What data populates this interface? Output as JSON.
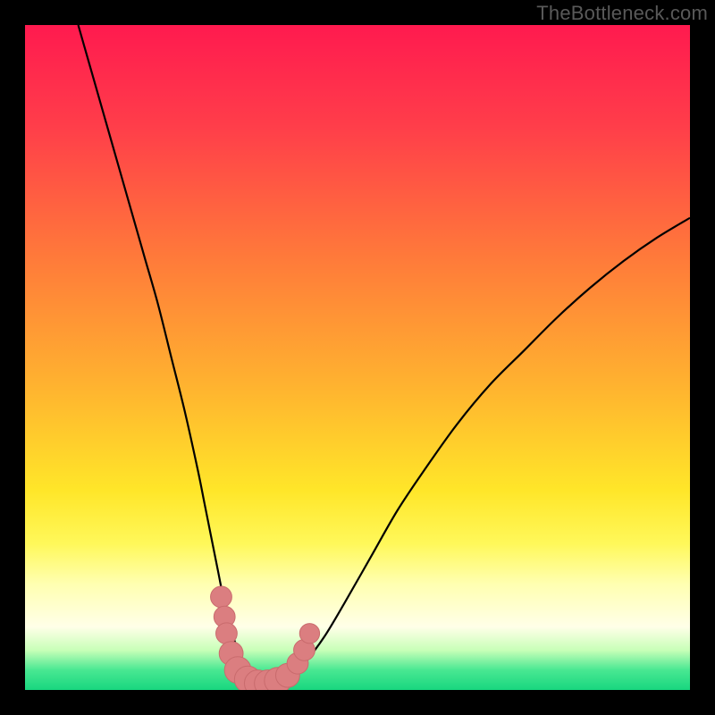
{
  "watermark": "TheBottleneck.com",
  "colors": {
    "frame": "#000000",
    "curve": "#000000",
    "marker_fill": "#db7e80",
    "marker_stroke": "#c96b6d",
    "gradient_stops": [
      {
        "offset": 0.0,
        "color": "#ff1a4f"
      },
      {
        "offset": 0.15,
        "color": "#ff3d4a"
      },
      {
        "offset": 0.35,
        "color": "#ff7a3a"
      },
      {
        "offset": 0.55,
        "color": "#ffb52f"
      },
      {
        "offset": 0.7,
        "color": "#ffe629"
      },
      {
        "offset": 0.78,
        "color": "#fff85a"
      },
      {
        "offset": 0.84,
        "color": "#ffffb0"
      },
      {
        "offset": 0.905,
        "color": "#ffffe8"
      },
      {
        "offset": 0.94,
        "color": "#c8ffb8"
      },
      {
        "offset": 0.97,
        "color": "#49e892"
      },
      {
        "offset": 1.0,
        "color": "#18d67f"
      }
    ]
  },
  "chart_data": {
    "type": "line",
    "title": "",
    "xlabel": "",
    "ylabel": "",
    "xlim": [
      0,
      100
    ],
    "ylim": [
      0,
      100
    ],
    "curve": {
      "x": [
        8,
        10,
        12,
        14,
        16,
        18,
        20,
        22,
        24,
        26,
        27,
        28,
        29,
        30,
        31,
        32,
        33,
        34,
        35,
        36,
        37,
        38,
        40,
        42,
        45,
        48,
        52,
        56,
        60,
        65,
        70,
        75,
        80,
        85,
        90,
        95,
        100
      ],
      "y": [
        100,
        93,
        86,
        79,
        72,
        65,
        58,
        50,
        42,
        33,
        28,
        23,
        18,
        13,
        9,
        6,
        3.5,
        2,
        1.2,
        1,
        1,
        1.2,
        2,
        4,
        8,
        13,
        20,
        27,
        33,
        40,
        46,
        51,
        56,
        60.5,
        64.5,
        68,
        71
      ]
    },
    "markers": [
      {
        "x": 29.5,
        "y": 14,
        "r": 1.6
      },
      {
        "x": 30.0,
        "y": 11,
        "r": 1.6
      },
      {
        "x": 30.3,
        "y": 8.5,
        "r": 1.6
      },
      {
        "x": 31.0,
        "y": 5.5,
        "r": 1.8
      },
      {
        "x": 32.0,
        "y": 3.0,
        "r": 2.0
      },
      {
        "x": 33.5,
        "y": 1.6,
        "r": 2.0
      },
      {
        "x": 35.0,
        "y": 1.0,
        "r": 2.0
      },
      {
        "x": 36.5,
        "y": 1.0,
        "r": 2.0
      },
      {
        "x": 38.0,
        "y": 1.4,
        "r": 2.0
      },
      {
        "x": 39.5,
        "y": 2.2,
        "r": 1.8
      },
      {
        "x": 41.0,
        "y": 4.0,
        "r": 1.6
      },
      {
        "x": 42.0,
        "y": 6.0,
        "r": 1.6
      },
      {
        "x": 42.8,
        "y": 8.5,
        "r": 1.5
      }
    ]
  }
}
